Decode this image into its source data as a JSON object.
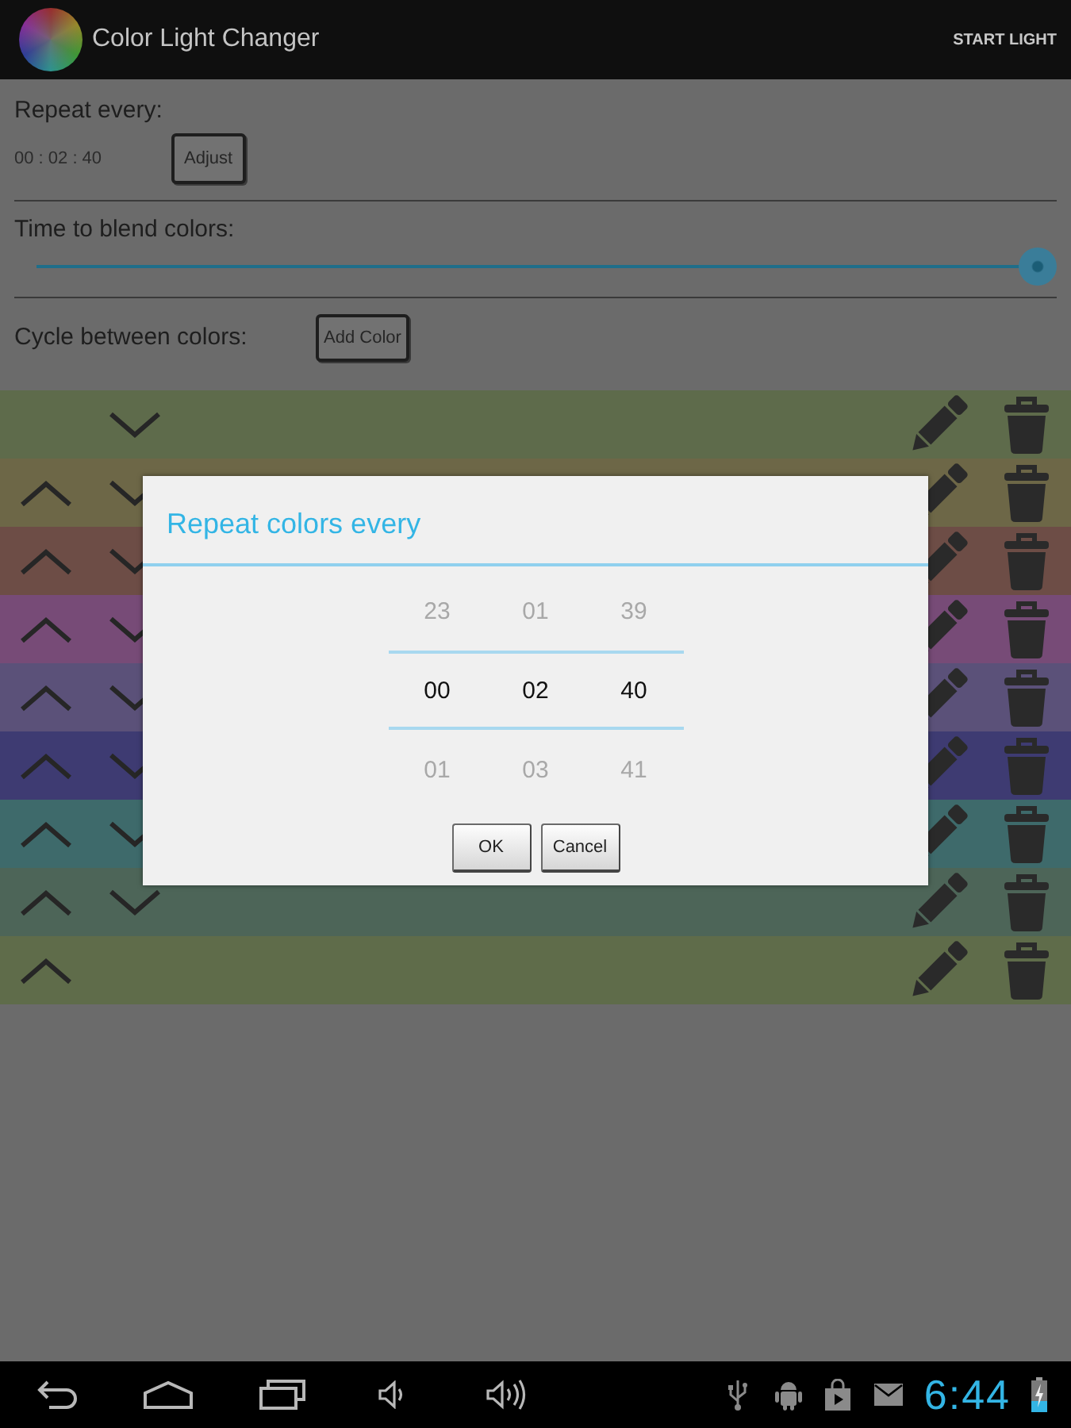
{
  "action_bar": {
    "title": "Color Light Changer",
    "action": "START LIGHT"
  },
  "repeat": {
    "label": "Repeat every:",
    "value": "00 : 02 : 40",
    "button": "Adjust"
  },
  "blend": {
    "label": "Time to blend colors:",
    "level": 1.0
  },
  "cycle": {
    "label": "Cycle between colors:",
    "button": "Add Color"
  },
  "colors": [
    {
      "color": "#5e6b4b",
      "can_move_up": false,
      "can_move_down": true
    },
    {
      "color": "#6d6747",
      "can_move_up": true,
      "can_move_down": true
    },
    {
      "color": "#6d4d46",
      "can_move_up": true,
      "can_move_down": true
    },
    {
      "color": "#774b77",
      "can_move_up": true,
      "can_move_down": true
    },
    {
      "color": "#5b5179",
      "can_move_up": true,
      "can_move_down": true
    },
    {
      "color": "#3e3b72",
      "can_move_up": true,
      "can_move_down": true
    },
    {
      "color": "#3e6a6b",
      "can_move_up": true,
      "can_move_down": true
    },
    {
      "color": "#4d6558",
      "can_move_up": true,
      "can_move_down": true
    },
    {
      "color": "#5f6c4a",
      "can_move_up": true,
      "can_move_down": false
    }
  ],
  "dialog": {
    "title": "Repeat colors every",
    "columns": [
      {
        "items": [
          {
            "text": "23",
            "selected": false
          },
          {
            "text": "00",
            "selected": true
          },
          {
            "text": "01",
            "selected": false
          }
        ]
      },
      {
        "items": [
          {
            "text": "01",
            "selected": false
          },
          {
            "text": "02",
            "selected": true
          },
          {
            "text": "03",
            "selected": false
          }
        ]
      },
      {
        "items": [
          {
            "text": "39",
            "selected": false
          },
          {
            "text": "40",
            "selected": true
          },
          {
            "text": "41",
            "selected": false
          }
        ]
      }
    ],
    "buttons": [
      "OK",
      "Cancel"
    ]
  },
  "nav_bar": {
    "time": "6:44"
  }
}
